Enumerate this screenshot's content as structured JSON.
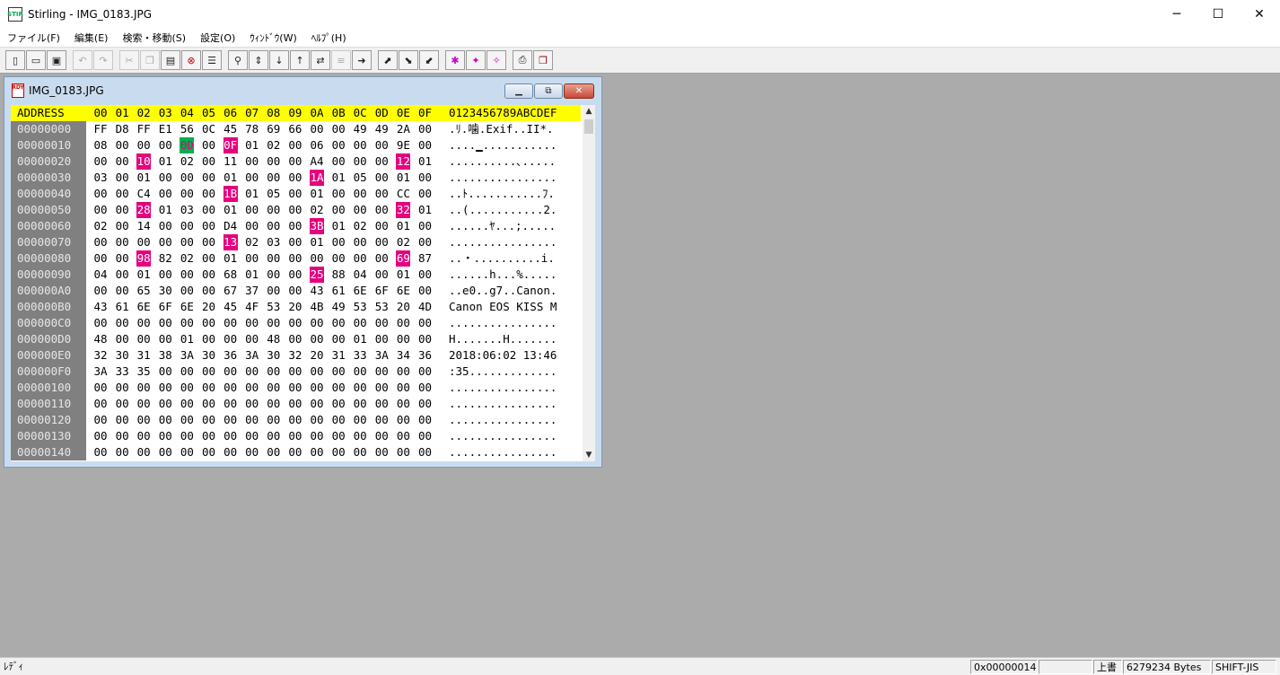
{
  "window": {
    "title": "Stirling - IMG_0183.JPG",
    "icon_text": "STIR",
    "min": "─",
    "max": "☐",
    "close": "✕"
  },
  "menu": [
    "ファイル(F)",
    "編集(E)",
    "検索・移動(S)",
    "設定(O)",
    "ｳｨﾝﾄﾞｳ(W)",
    "ﾍﾙﾌﾟ(H)"
  ],
  "toolbar": [
    "new-icon",
    "open-icon",
    "save-icon",
    "undo-icon",
    "redo-icon",
    "cut-icon",
    "copy-icon",
    "paste-icon",
    "delete-icon",
    "list-icon",
    "find-icon",
    "find-next-icon",
    "find-down-icon",
    "find-up-icon",
    "replace-icon",
    "compare-icon",
    "jump-icon",
    "insert-file-icon",
    "export-down-icon",
    "export-right-icon",
    "mark-icon",
    "mark-down-icon",
    "mark-up-icon",
    "print-icon",
    "book-icon"
  ],
  "child": {
    "title": "IMG_0183.JPG",
    "doc_icon_text": "RDY"
  },
  "hex": {
    "header_addr": "ADDRESS",
    "header_cols": [
      "00",
      "01",
      "02",
      "03",
      "04",
      "05",
      "06",
      "07",
      "08",
      "09",
      "0A",
      "0B",
      "0C",
      "0D",
      "0E",
      "0F"
    ],
    "header_ascii": "0123456789ABCDEF",
    "rows": [
      {
        "addr": "00000000",
        "bytes": [
          "FF",
          "D8",
          "FF",
          "E1",
          "56",
          "0C",
          "45",
          "78",
          "69",
          "66",
          "00",
          "00",
          "49",
          "49",
          "2A",
          "00"
        ],
        "ascii": ".ﾘ.噛.Exif..II*."
      },
      {
        "addr": "00000010",
        "bytes": [
          "08",
          "00",
          "00",
          "00",
          "0D",
          "00",
          "0F",
          "01",
          "02",
          "00",
          "06",
          "00",
          "00",
          "00",
          "9E",
          "00"
        ],
        "ascii": "....▁..........."
      },
      {
        "addr": "00000020",
        "bytes": [
          "00",
          "00",
          "10",
          "01",
          "02",
          "00",
          "11",
          "00",
          "00",
          "00",
          "A4",
          "00",
          "00",
          "00",
          "12",
          "01"
        ],
        "ascii": "..........､....."
      },
      {
        "addr": "00000030",
        "bytes": [
          "03",
          "00",
          "01",
          "00",
          "00",
          "00",
          "01",
          "00",
          "00",
          "00",
          "1A",
          "01",
          "05",
          "00",
          "01",
          "00"
        ],
        "ascii": "................"
      },
      {
        "addr": "00000040",
        "bytes": [
          "00",
          "00",
          "C4",
          "00",
          "00",
          "00",
          "1B",
          "01",
          "05",
          "00",
          "01",
          "00",
          "00",
          "00",
          "CC",
          "00"
        ],
        "ascii": "..ﾄ...........ﾌ."
      },
      {
        "addr": "00000050",
        "bytes": [
          "00",
          "00",
          "28",
          "01",
          "03",
          "00",
          "01",
          "00",
          "00",
          "00",
          "02",
          "00",
          "00",
          "00",
          "32",
          "01"
        ],
        "ascii": "..(...........2."
      },
      {
        "addr": "00000060",
        "bytes": [
          "02",
          "00",
          "14",
          "00",
          "00",
          "00",
          "D4",
          "00",
          "00",
          "00",
          "3B",
          "01",
          "02",
          "00",
          "01",
          "00"
        ],
        "ascii": "......ﾔ...;....."
      },
      {
        "addr": "00000070",
        "bytes": [
          "00",
          "00",
          "00",
          "00",
          "00",
          "00",
          "13",
          "02",
          "03",
          "00",
          "01",
          "00",
          "00",
          "00",
          "02",
          "00"
        ],
        "ascii": "................"
      },
      {
        "addr": "00000080",
        "bytes": [
          "00",
          "00",
          "98",
          "82",
          "02",
          "00",
          "01",
          "00",
          "00",
          "00",
          "00",
          "00",
          "00",
          "00",
          "69",
          "87"
        ],
        "ascii": "..・..........i."
      },
      {
        "addr": "00000090",
        "bytes": [
          "04",
          "00",
          "01",
          "00",
          "00",
          "00",
          "68",
          "01",
          "00",
          "00",
          "25",
          "88",
          "04",
          "00",
          "01",
          "00"
        ],
        "ascii": "......h...%....."
      },
      {
        "addr": "000000A0",
        "bytes": [
          "00",
          "00",
          "65",
          "30",
          "00",
          "00",
          "67",
          "37",
          "00",
          "00",
          "43",
          "61",
          "6E",
          "6F",
          "6E",
          "00"
        ],
        "ascii": "..e0..g7..Canon."
      },
      {
        "addr": "000000B0",
        "bytes": [
          "43",
          "61",
          "6E",
          "6F",
          "6E",
          "20",
          "45",
          "4F",
          "53",
          "20",
          "4B",
          "49",
          "53",
          "53",
          "20",
          "4D"
        ],
        "ascii": "Canon EOS KISS M"
      },
      {
        "addr": "000000C0",
        "bytes": [
          "00",
          "00",
          "00",
          "00",
          "00",
          "00",
          "00",
          "00",
          "00",
          "00",
          "00",
          "00",
          "00",
          "00",
          "00",
          "00"
        ],
        "ascii": "................"
      },
      {
        "addr": "000000D0",
        "bytes": [
          "48",
          "00",
          "00",
          "00",
          "01",
          "00",
          "00",
          "00",
          "48",
          "00",
          "00",
          "00",
          "01",
          "00",
          "00",
          "00"
        ],
        "ascii": "H.......H......."
      },
      {
        "addr": "000000E0",
        "bytes": [
          "32",
          "30",
          "31",
          "38",
          "3A",
          "30",
          "36",
          "3A",
          "30",
          "32",
          "20",
          "31",
          "33",
          "3A",
          "34",
          "36"
        ],
        "ascii": "2018:06:02 13:46"
      },
      {
        "addr": "000000F0",
        "bytes": [
          "3A",
          "33",
          "35",
          "00",
          "00",
          "00",
          "00",
          "00",
          "00",
          "00",
          "00",
          "00",
          "00",
          "00",
          "00",
          "00"
        ],
        "ascii": ":35............."
      },
      {
        "addr": "00000100",
        "bytes": [
          "00",
          "00",
          "00",
          "00",
          "00",
          "00",
          "00",
          "00",
          "00",
          "00",
          "00",
          "00",
          "00",
          "00",
          "00",
          "00"
        ],
        "ascii": "................"
      },
      {
        "addr": "00000110",
        "bytes": [
          "00",
          "00",
          "00",
          "00",
          "00",
          "00",
          "00",
          "00",
          "00",
          "00",
          "00",
          "00",
          "00",
          "00",
          "00",
          "00"
        ],
        "ascii": "................"
      },
      {
        "addr": "00000120",
        "bytes": [
          "00",
          "00",
          "00",
          "00",
          "00",
          "00",
          "00",
          "00",
          "00",
          "00",
          "00",
          "00",
          "00",
          "00",
          "00",
          "00"
        ],
        "ascii": "................"
      },
      {
        "addr": "00000130",
        "bytes": [
          "00",
          "00",
          "00",
          "00",
          "00",
          "00",
          "00",
          "00",
          "00",
          "00",
          "00",
          "00",
          "00",
          "00",
          "00",
          "00"
        ],
        "ascii": "................"
      },
      {
        "addr": "00000140",
        "bytes": [
          "00",
          "00",
          "00",
          "00",
          "00",
          "00",
          "00",
          "00",
          "00",
          "00",
          "00",
          "00",
          "00",
          "00",
          "00",
          "00"
        ],
        "ascii": "................"
      }
    ],
    "highlights": [
      [
        1,
        6
      ],
      [
        2,
        2
      ],
      [
        2,
        14
      ],
      [
        3,
        10
      ],
      [
        4,
        6
      ],
      [
        5,
        2
      ],
      [
        5,
        14
      ],
      [
        6,
        10
      ],
      [
        7,
        6
      ],
      [
        8,
        2
      ],
      [
        8,
        14
      ],
      [
        9,
        10
      ]
    ],
    "cursor": [
      1,
      4
    ]
  },
  "status": {
    "left": "ﾚﾃﾞｨ",
    "offset": "0x00000014",
    "mode": "上書",
    "size": "6279234 Bytes",
    "encoding": "SHIFT-JIS"
  },
  "colors": {
    "header_bg": "#ffff00",
    "highlight_bg": "#e6007e",
    "cursor_bg": "#00b050",
    "address_bg": "#808080",
    "mdi_bg": "#ababab"
  }
}
